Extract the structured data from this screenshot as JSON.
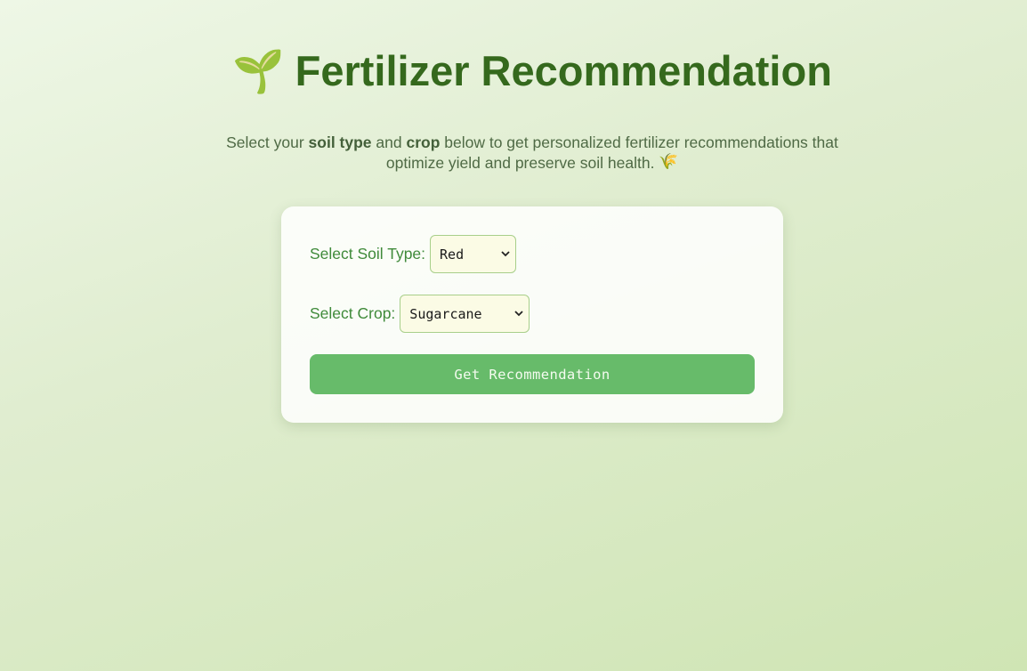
{
  "header": {
    "title_icon": "🌱",
    "title_icon_name": "seedling-icon",
    "title": "Fertilizer Recommendation"
  },
  "intro": {
    "part1": "Select your ",
    "bold1": "soil type",
    "part2": " and ",
    "bold2": "crop",
    "part3": " below to get personalized fertilizer recommendations that optimize yield and preserve soil health. ",
    "end_icon": "🌾",
    "end_icon_name": "wheat-icon"
  },
  "form": {
    "soil_label": "Select Soil Type:",
    "soil_value": "Red",
    "crop_label": "Select Crop:",
    "crop_value": "Sugarcane",
    "submit_label": "Get Recommendation"
  },
  "colors": {
    "title": "#35691d",
    "label": "#3f8a3a",
    "button": "#67bb6a",
    "select_bg": "#fbfbe5"
  }
}
